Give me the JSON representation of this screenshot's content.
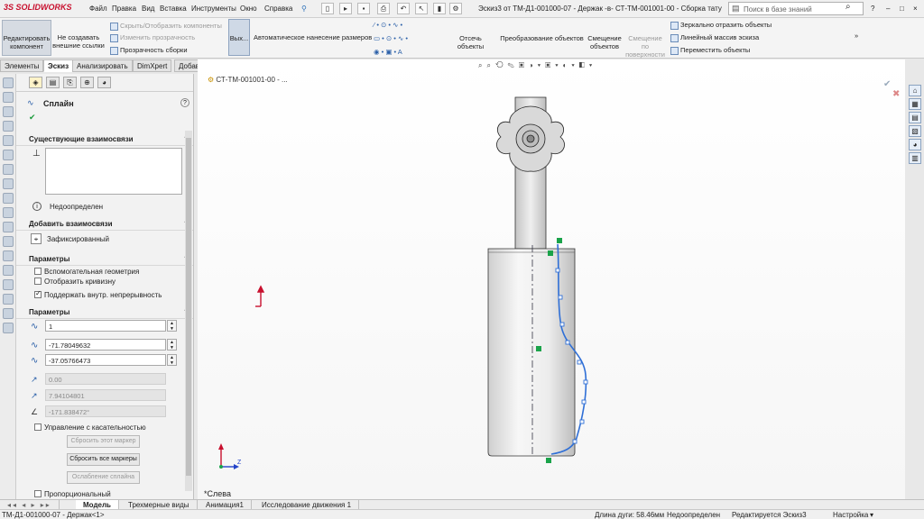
{
  "app": {
    "logo_prefix": "3S",
    "logo_text": "SOLIDWORKS"
  },
  "menu": [
    "Файл",
    "Правка",
    "Вид",
    "Вставка",
    "Инструменты",
    "Окно",
    "Справка"
  ],
  "document_title": "Эскиз3 от ТМ-Д1-001000-07 - Держак -в- СТ-ТМ-001001-00 - Сборка тату м...",
  "search": {
    "placeholder": "Поиск в базе знаний"
  },
  "window_controls": {
    "help": "?",
    "minimize": "–",
    "restore": "□",
    "close": "×"
  },
  "ribbon": {
    "edit_component": "Редактировать компонент",
    "no_external_refs": "Не создавать внешние ссылки",
    "hide_show": "Скрыть/Отобразить компоненты",
    "change_transparency": "Изменить прозрачность",
    "assembly_transparency": "Прозрачность сборки",
    "exit_sketch": "Вых...",
    "smart_dimension": "Автоматическое нанесение размеров",
    "trim_entities": "Отсечь объекты",
    "convert_entities": "Преобразование объектов",
    "offset_entities": "Смещение объектов",
    "offset_on_surface": "Смещение по поверхности",
    "mirror_entities": "Зеркально отразить объекты",
    "linear_pattern": "Линейный массив эскиза",
    "move_entities": "Переместить объекты",
    "more": "»"
  },
  "tabs": [
    "Элементы",
    "Эскиз",
    "Анализировать",
    "DimXpert",
    "Добавления SOLIDWORKS"
  ],
  "active_tab": "Эскиз",
  "property_manager": {
    "title": "Сплайн",
    "help": "?",
    "existing_relations": {
      "header": "Существующие взаимосвязи",
      "status": "Недоопределен"
    },
    "add_relations": {
      "header": "Добавить взаимосвязи",
      "fixed": "Зафиксированный"
    },
    "options": {
      "header": "Параметры",
      "construction_geometry": {
        "label": "Вспомогательная геометрия",
        "checked": false
      },
      "show_curvature": {
        "label": "Отобразить кривизну",
        "checked": false
      },
      "maintain_continuity": {
        "label": "Поддержать внутр. непрерывность",
        "checked": true
      }
    },
    "parameters": {
      "header": "Параметры",
      "point_number": "1",
      "x_coord": "-71.78049632",
      "y_coord": "-37.05766473",
      "tangent_weight_1": "0.00",
      "tangent_weight_2": "7.94104801",
      "tangent_angle": "-171.838472°",
      "tangent_driving": {
        "label": "Управление с касательностью",
        "checked": false
      },
      "reset_this_handle": "Сбросить этот маркер",
      "reset_all_handles": "Сбросить все маркеры",
      "relax_spline": "Ослабление сплайна",
      "proportional": {
        "label": "Пропорциональный",
        "checked": false
      }
    }
  },
  "viewport": {
    "breadcrumb": "СТ-ТМ-001001-00 - ...",
    "view_name": "*Слева",
    "triad": {
      "z": "Z"
    }
  },
  "bottom_tabs": [
    "Модель",
    "Трехмерные виды",
    "Анимация1",
    "Исследование движения 1"
  ],
  "active_bottom_tab": "Модель",
  "status": {
    "document": "ТМ-Д1-001000-07 - Держак<1>",
    "arc_length": "Длина дуги: 58.46мм",
    "definition": "Недоопределен",
    "editing": "Редактируется Эскиз3",
    "customize": "Настройка"
  },
  "colors": {
    "spline": "#2f6fd6",
    "relation_marker": "#1aa34a",
    "accent": "#c8102e"
  }
}
